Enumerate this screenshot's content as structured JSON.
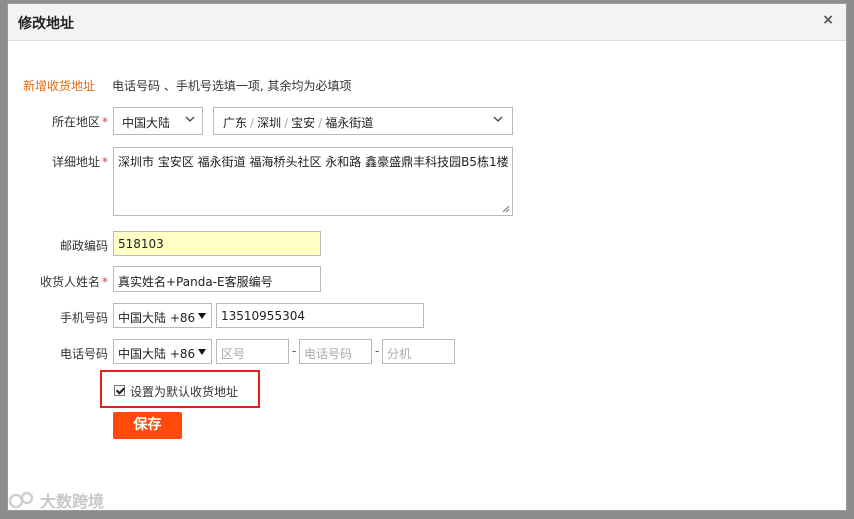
{
  "dialog": {
    "title": "修改地址",
    "close_glyph": "×"
  },
  "form": {
    "section_title": "新增收货地址",
    "hint": "电话号码 、手机号选填一项, 其余均为必填项",
    "required_mark": "*",
    "region": {
      "label": "所在地区",
      "country": "中国大陆",
      "province": "广东",
      "city": "深圳",
      "district": "宝安",
      "street": "福永街道",
      "separator": "/"
    },
    "address": {
      "label": "详细地址",
      "value": "深圳市 宝安区 福永街道 福海桥头社区 永和路 鑫豪盛鼎丰科技园B5栋1楼"
    },
    "postal": {
      "label": "邮政编码",
      "value": "518103"
    },
    "recipient": {
      "label": "收货人姓名",
      "value": "真实姓名+Panda-E客服编号"
    },
    "mobile": {
      "label": "手机号码",
      "country_code": "中国大陆 +86",
      "value": "13510955304"
    },
    "phone": {
      "label": "电话号码",
      "country_code": "中国大陆 +86",
      "area_placeholder": "区号",
      "number_placeholder": "电话号码",
      "ext_placeholder": "分机",
      "dash": "-"
    },
    "default_checkbox": {
      "label": "设置为默认收货地址",
      "checked": true
    },
    "save_label": "保存"
  },
  "watermark": {
    "text": "大数跨境"
  },
  "colors": {
    "accent_orange": "#e06b14",
    "required_red": "#e4393c",
    "save_button": "#ff4a0a",
    "highlight_border": "#e02020",
    "postal_field_bg": "#ffffc6"
  },
  "icons": {
    "close": "close-icon",
    "dropdown": "chevron-down-icon",
    "select_arrow": "triangle-down-icon",
    "checkbox": "checkbox-checked-icon",
    "resize": "resize-handle-icon"
  }
}
